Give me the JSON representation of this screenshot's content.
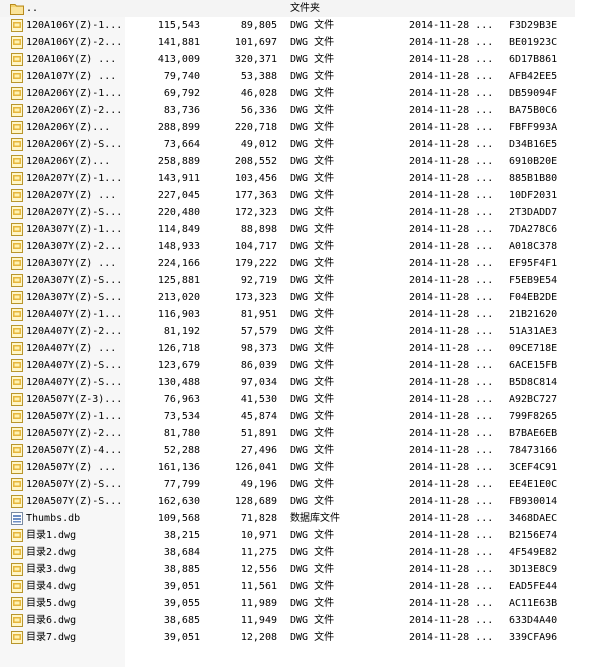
{
  "parent": {
    "name": "..",
    "type": "文件夹"
  },
  "files": [
    {
      "name": "120A106Y(Z)-1...",
      "size": "115,543",
      "packed": "89,805",
      "type": "DWG 文件",
      "modified": "2014-11-28 ...",
      "crc": "F3D29B3E",
      "icon": "dwg-file-icon"
    },
    {
      "name": "120A106Y(Z)-2...",
      "size": "141,881",
      "packed": "101,697",
      "type": "DWG 文件",
      "modified": "2014-11-28 ...",
      "crc": "BE01923C",
      "icon": "dwg-file-icon"
    },
    {
      "name": "120A106Y(Z) ...",
      "size": "413,009",
      "packed": "320,371",
      "type": "DWG 文件",
      "modified": "2014-11-28 ...",
      "crc": "6D17B861",
      "icon": "dwg-file-icon"
    },
    {
      "name": "120A107Y(Z) ...",
      "size": "79,740",
      "packed": "53,388",
      "type": "DWG 文件",
      "modified": "2014-11-28 ...",
      "crc": "AFB42EE5",
      "icon": "dwg-file-icon"
    },
    {
      "name": "120A206Y(Z)-1...",
      "size": "69,792",
      "packed": "46,028",
      "type": "DWG 文件",
      "modified": "2014-11-28 ...",
      "crc": "DB59094F",
      "icon": "dwg-file-icon"
    },
    {
      "name": "120A206Y(Z)-2...",
      "size": "83,736",
      "packed": "56,336",
      "type": "DWG 文件",
      "modified": "2014-11-28 ...",
      "crc": "BA75B0C6",
      "icon": "dwg-file-icon"
    },
    {
      "name": "120A206Y(Z)...",
      "size": "288,899",
      "packed": "220,718",
      "type": "DWG 文件",
      "modified": "2014-11-28 ...",
      "crc": "FBFF993A",
      "icon": "dwg-file-icon"
    },
    {
      "name": "120A206Y(Z)-S...",
      "size": "73,664",
      "packed": "49,012",
      "type": "DWG 文件",
      "modified": "2014-11-28 ...",
      "crc": "D34B16E5",
      "icon": "dwg-file-icon"
    },
    {
      "name": "120A206Y(Z)...",
      "size": "258,889",
      "packed": "208,552",
      "type": "DWG 文件",
      "modified": "2014-11-28 ...",
      "crc": "6910B20E",
      "icon": "dwg-file-icon"
    },
    {
      "name": "120A207Y(Z)-1...",
      "size": "143,911",
      "packed": "103,456",
      "type": "DWG 文件",
      "modified": "2014-11-28 ...",
      "crc": "885B1B80",
      "icon": "dwg-file-icon"
    },
    {
      "name": "120A207Y(Z) ...",
      "size": "227,045",
      "packed": "177,363",
      "type": "DWG 文件",
      "modified": "2014-11-28 ...",
      "crc": "10DF2031",
      "icon": "dwg-file-icon"
    },
    {
      "name": "120A207Y(Z)-S...",
      "size": "220,480",
      "packed": "172,323",
      "type": "DWG 文件",
      "modified": "2014-11-28 ...",
      "crc": "2T3DADD7",
      "icon": "dwg-file-icon"
    },
    {
      "name": "120A307Y(Z)-1...",
      "size": "114,849",
      "packed": "88,898",
      "type": "DWG 文件",
      "modified": "2014-11-28 ...",
      "crc": "7DA278C6",
      "icon": "dwg-file-icon"
    },
    {
      "name": "120A307Y(Z)-2...",
      "size": "148,933",
      "packed": "104,717",
      "type": "DWG 文件",
      "modified": "2014-11-28 ...",
      "crc": "A018C378",
      "icon": "dwg-file-icon"
    },
    {
      "name": "120A307Y(Z) ...",
      "size": "224,166",
      "packed": "179,222",
      "type": "DWG 文件",
      "modified": "2014-11-28 ...",
      "crc": "EF95F4F1",
      "icon": "dwg-file-icon"
    },
    {
      "name": "120A307Y(Z)-S...",
      "size": "125,881",
      "packed": "92,719",
      "type": "DWG 文件",
      "modified": "2014-11-28 ...",
      "crc": "F5EB9E54",
      "icon": "dwg-file-icon"
    },
    {
      "name": "120A307Y(Z)-S...",
      "size": "213,020",
      "packed": "173,323",
      "type": "DWG 文件",
      "modified": "2014-11-28 ...",
      "crc": "F04EB2DE",
      "icon": "dwg-file-icon"
    },
    {
      "name": "120A407Y(Z)-1...",
      "size": "116,903",
      "packed": "81,951",
      "type": "DWG 文件",
      "modified": "2014-11-28 ...",
      "crc": "21B21620",
      "icon": "dwg-file-icon"
    },
    {
      "name": "120A407Y(Z)-2...",
      "size": "81,192",
      "packed": "57,579",
      "type": "DWG 文件",
      "modified": "2014-11-28 ...",
      "crc": "51A31AE3",
      "icon": "dwg-file-icon"
    },
    {
      "name": "120A407Y(Z) ...",
      "size": "126,718",
      "packed": "98,373",
      "type": "DWG 文件",
      "modified": "2014-11-28 ...",
      "crc": "09CE718E",
      "icon": "dwg-file-icon"
    },
    {
      "name": "120A407Y(Z)-S...",
      "size": "123,679",
      "packed": "86,039",
      "type": "DWG 文件",
      "modified": "2014-11-28 ...",
      "crc": "6ACE15FB",
      "icon": "dwg-file-icon"
    },
    {
      "name": "120A407Y(Z)-S...",
      "size": "130,488",
      "packed": "97,034",
      "type": "DWG 文件",
      "modified": "2014-11-28 ...",
      "crc": "B5D8C814",
      "icon": "dwg-file-icon"
    },
    {
      "name": "120A507Y(Z-3)...",
      "size": "76,963",
      "packed": "41,530",
      "type": "DWG 文件",
      "modified": "2014-11-28 ...",
      "crc": "A92BC727",
      "icon": "dwg-file-icon"
    },
    {
      "name": "120A507Y(Z)-1...",
      "size": "73,534",
      "packed": "45,874",
      "type": "DWG 文件",
      "modified": "2014-11-28 ...",
      "crc": "799F8265",
      "icon": "dwg-file-icon"
    },
    {
      "name": "120A507Y(Z)-2...",
      "size": "81,780",
      "packed": "51,891",
      "type": "DWG 文件",
      "modified": "2014-11-28 ...",
      "crc": "B7BAE6EB",
      "icon": "dwg-file-icon"
    },
    {
      "name": "120A507Y(Z)-4...",
      "size": "52,288",
      "packed": "27,496",
      "type": "DWG 文件",
      "modified": "2014-11-28 ...",
      "crc": "78473166",
      "icon": "dwg-file-icon"
    },
    {
      "name": "120A507Y(Z) ...",
      "size": "161,136",
      "packed": "126,041",
      "type": "DWG 文件",
      "modified": "2014-11-28 ...",
      "crc": "3CEF4C91",
      "icon": "dwg-file-icon"
    },
    {
      "name": "120A507Y(Z)-S...",
      "size": "77,799",
      "packed": "49,196",
      "type": "DWG 文件",
      "modified": "2014-11-28 ...",
      "crc": "EE4E1E0C",
      "icon": "dwg-file-icon"
    },
    {
      "name": "120A507Y(Z)-S...",
      "size": "162,630",
      "packed": "128,689",
      "type": "DWG 文件",
      "modified": "2014-11-28 ...",
      "crc": "FB930014",
      "icon": "dwg-file-icon"
    },
    {
      "name": "Thumbs.db",
      "size": "109,568",
      "packed": "71,828",
      "type": "数据库文件",
      "modified": "2014-11-28 ...",
      "crc": "3468DAEC",
      "icon": "database-file-icon"
    },
    {
      "name": "目录1.dwg",
      "size": "38,215",
      "packed": "10,971",
      "type": "DWG 文件",
      "modified": "2014-11-28 ...",
      "crc": "B2156E74",
      "icon": "dwg-file-icon"
    },
    {
      "name": "目录2.dwg",
      "size": "38,684",
      "packed": "11,275",
      "type": "DWG 文件",
      "modified": "2014-11-28 ...",
      "crc": "4F549E82",
      "icon": "dwg-file-icon"
    },
    {
      "name": "目录3.dwg",
      "size": "38,885",
      "packed": "12,556",
      "type": "DWG 文件",
      "modified": "2014-11-28 ...",
      "crc": "3D13E8C9",
      "icon": "dwg-file-icon"
    },
    {
      "name": "目录4.dwg",
      "size": "39,051",
      "packed": "11,561",
      "type": "DWG 文件",
      "modified": "2014-11-28 ...",
      "crc": "EAD5FE44",
      "icon": "dwg-file-icon"
    },
    {
      "name": "目录5.dwg",
      "size": "39,055",
      "packed": "11,989",
      "type": "DWG 文件",
      "modified": "2014-11-28 ...",
      "crc": "AC11E63B",
      "icon": "dwg-file-icon"
    },
    {
      "name": "目录6.dwg",
      "size": "38,685",
      "packed": "11,949",
      "type": "DWG 文件",
      "modified": "2014-11-28 ...",
      "crc": "633D4A40",
      "icon": "dwg-file-icon"
    },
    {
      "name": "目录7.dwg",
      "size": "39,051",
      "packed": "12,208",
      "type": "DWG 文件",
      "modified": "2014-11-28 ...",
      "crc": "339CFA96",
      "icon": "dwg-file-icon"
    }
  ]
}
